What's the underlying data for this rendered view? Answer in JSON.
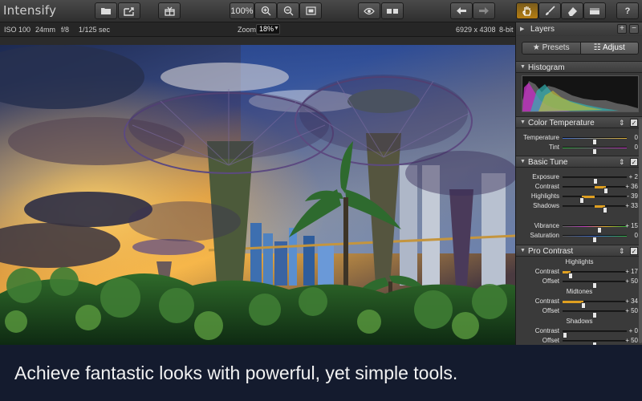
{
  "app": {
    "title": "Intensify"
  },
  "toolbar": {
    "zoom_value": "100%",
    "icons": [
      "folder-icon",
      "share-icon",
      "gift-icon",
      "zoom-in-icon",
      "zoom-out-icon",
      "fit-icon",
      "eye-icon",
      "compare-icon",
      "undo-icon",
      "redo-icon",
      "hand-tool-icon",
      "brush-icon",
      "eraser-icon",
      "gradient-icon",
      "help-icon"
    ],
    "active_tool": "hand-tool-icon",
    "help_label": "?"
  },
  "infobar": {
    "iso": "ISO 100",
    "focal": "24mm",
    "aperture": "f/8",
    "shutter": "1/125 sec",
    "zoom_label": "Zoom:",
    "zoom_value": "18%",
    "dimensions": "6929 x 4308",
    "bit_depth": "8-bit"
  },
  "caption": {
    "text": "Achieve fantastic looks with powerful, yet simple tools."
  },
  "panel": {
    "layers_title": "Layers",
    "add_label": "+",
    "remove_label": "−",
    "tabs": [
      {
        "label": "Presets",
        "icon": "star-icon"
      },
      {
        "label": "Adjust",
        "icon": "sliders-icon",
        "selected": true
      }
    ],
    "histogram_title": "Histogram",
    "sections": {
      "color_temperature": {
        "title": "Color Temperature",
        "rows": [
          {
            "label": "Temperature",
            "value": "0",
            "pos": 0.5
          },
          {
            "label": "Tint",
            "value": "0",
            "pos": 0.5
          }
        ]
      },
      "basic_tune": {
        "title": "Basic Tune",
        "rows": [
          {
            "label": "Exposure",
            "value": "+ 2",
            "pos": 0.51
          },
          {
            "label": "Contrast",
            "value": "+ 36",
            "pos": 0.68
          },
          {
            "label": "Highlights",
            "value": "- 39",
            "pos": 0.3
          },
          {
            "label": "Shadows",
            "value": "+ 33",
            "pos": 0.66
          },
          {
            "label": "Vibrance",
            "value": "+ 15",
            "pos": 0.57
          },
          {
            "label": "Saturation",
            "value": "0",
            "pos": 0.5
          }
        ]
      },
      "pro_contrast": {
        "title": "Pro Contrast",
        "groups": [
          {
            "title": "Highlights",
            "rows": [
              {
                "label": "Contrast",
                "value": "+ 17",
                "pos": 0.1
              },
              {
                "label": "Offset",
                "value": "+ 50",
                "pos": 0.5
              }
            ]
          },
          {
            "title": "Midtones",
            "rows": [
              {
                "label": "Contrast",
                "value": "+ 34",
                "pos": 0.33
              },
              {
                "label": "Offset",
                "value": "+ 50",
                "pos": 0.5
              }
            ]
          },
          {
            "title": "Shadows",
            "rows": [
              {
                "label": "Contrast",
                "value": "+ 0",
                "pos": 0.0
              },
              {
                "label": "Offset",
                "value": "+ 50",
                "pos": 0.5
              }
            ]
          }
        ]
      }
    },
    "check_mark": "✓",
    "reset_mark": "⇕"
  },
  "colors": {
    "accent": "#b57d12",
    "caption_bg": "#121a2e",
    "panel_bg": "#3a3a3a"
  }
}
